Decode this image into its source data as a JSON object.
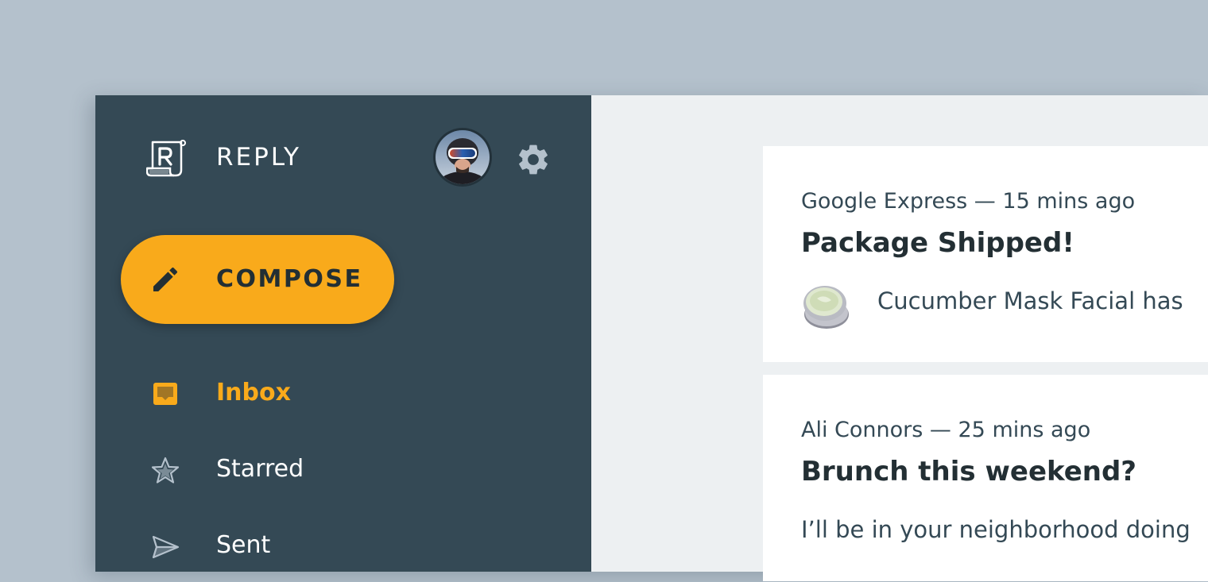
{
  "app": {
    "name": "REPLY"
  },
  "drawer": {
    "compose_label": "COMPOSE",
    "nav_items": [
      {
        "label": "Inbox",
        "icon": "inbox-icon",
        "active": true
      },
      {
        "label": "Starred",
        "icon": "star-icon",
        "active": false
      },
      {
        "label": "Sent",
        "icon": "send-icon",
        "active": false
      }
    ]
  },
  "emails": [
    {
      "sender": "Google Express",
      "time": "15 mins ago",
      "meta": "Google Express — 15 mins ago",
      "subject": "Package Shipped!",
      "preview": "Cucumber Mask Facial has",
      "has_thumbnail": true
    },
    {
      "sender": "Ali Connors",
      "time": "25 mins ago",
      "meta": "Ali Connors — 25 mins ago",
      "subject": "Brunch this weekend?",
      "preview": "I’ll be in your neighborhood doing",
      "has_thumbnail": false
    }
  ],
  "colors": {
    "background": "#b4c1cc",
    "drawer": "#344955",
    "accent": "#f9aa1b",
    "content": "#edf0f2",
    "text_dark": "#232f34"
  }
}
